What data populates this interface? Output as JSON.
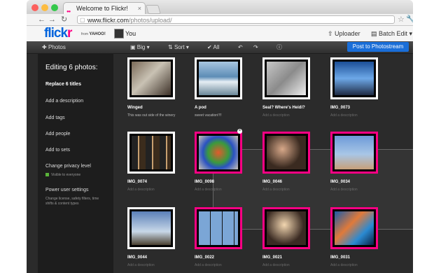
{
  "browser": {
    "tab_title": "Welcome to Flickr!",
    "url_host": "www.flickr.com",
    "url_path": "/photos/upload/"
  },
  "header": {
    "logo_blue": "flick",
    "logo_pink": "r",
    "from": "from",
    "yahoo": "YAHOO!",
    "you": "You",
    "uploader": "Uploader",
    "batch_edit": "Batch Edit"
  },
  "toolbar": {
    "photos": "Photos",
    "big": "Big",
    "sort": "Sort",
    "all": "All",
    "post": "Post to Photostream"
  },
  "sidebar": {
    "title": "Editing 6 photos:",
    "replace_titles": "Replace 6 titles",
    "add_description": "Add a description",
    "add_tags": "Add tags",
    "add_people": "Add people",
    "add_sets": "Add to sets",
    "privacy": "Change privacy level",
    "privacy_sub": "Visible to everyone",
    "power": "Power user settings",
    "power_sub1": "Change license, safety filters, time",
    "power_sub2": "shifts & content types"
  },
  "photos": [
    {
      "title": "Winged",
      "desc": "This was out side of the winery"
    },
    {
      "title": "A pod",
      "desc": "sweet vacation!!!!"
    },
    {
      "title": "Seal? Where's Heidi?",
      "desc": "Add a description"
    },
    {
      "title": "IMG_0073",
      "desc": "Add a description"
    },
    {
      "title": "IMG_0074",
      "desc": "Add a description"
    },
    {
      "title": "IMG_0098",
      "desc": "Add a description"
    },
    {
      "title": "IMG_0046",
      "desc": "Add a description"
    },
    {
      "title": "IMG_0034",
      "desc": "Add a description"
    },
    {
      "title": "IMG_0044",
      "desc": "Add a description"
    },
    {
      "title": "IMG_0022",
      "desc": "Add a description"
    },
    {
      "title": "IMG_0021",
      "desc": "Add a description"
    },
    {
      "title": "IMG_0031",
      "desc": "Add a description"
    }
  ],
  "colors": {
    "accent_blue": "#0063dc",
    "accent_pink": "#ff0084",
    "post_button": "#1a6ed8"
  }
}
